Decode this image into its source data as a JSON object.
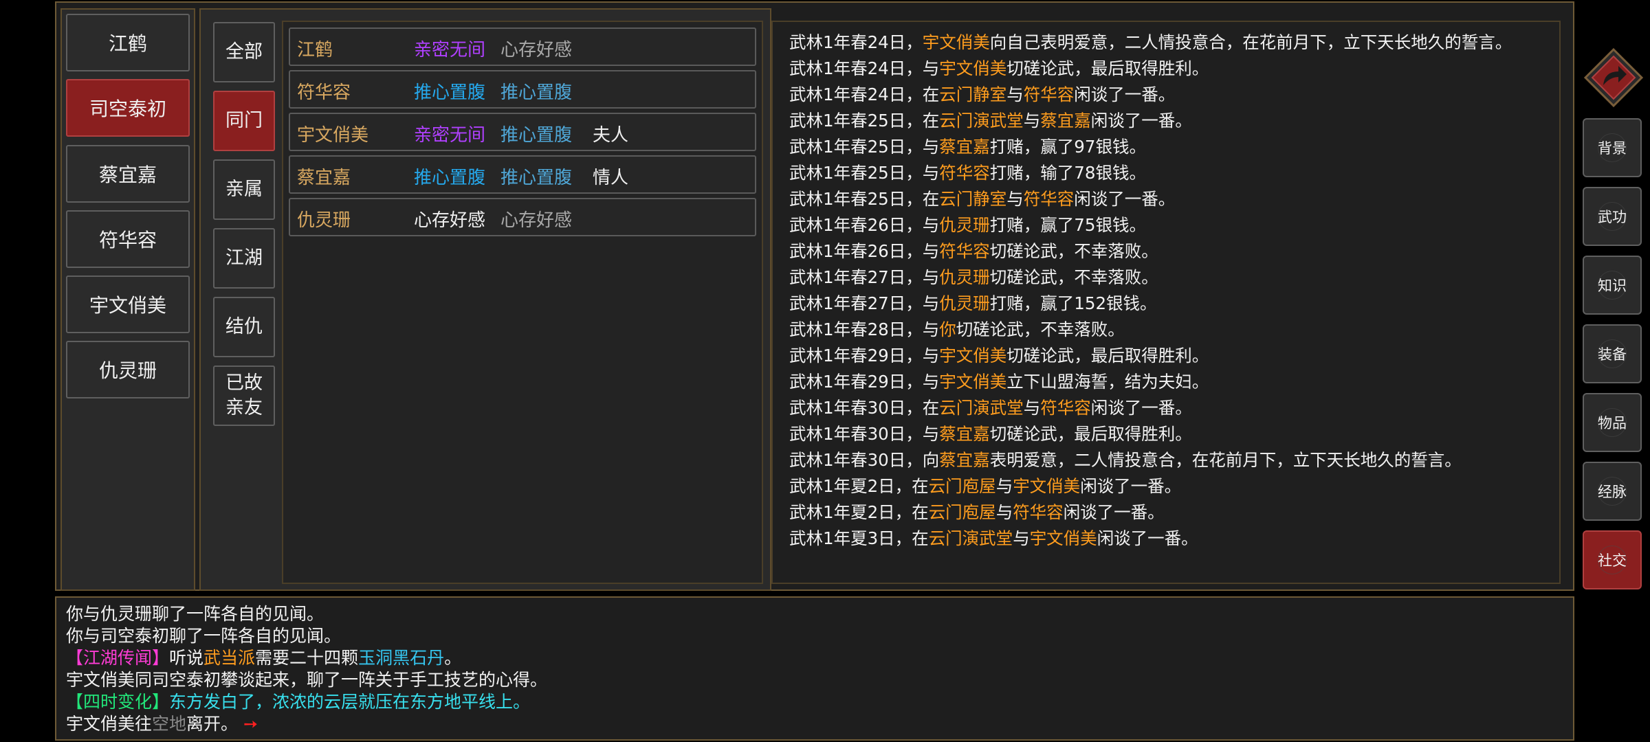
{
  "characters": [
    "江鹤",
    "司空泰初",
    "蔡宜嘉",
    "符华容",
    "宇文俏美",
    "仇灵珊"
  ],
  "active_character_index": 1,
  "categories": [
    "全部",
    "同门",
    "亲属",
    "江湖",
    "结仇",
    "已故\n亲友"
  ],
  "active_category_index": 1,
  "colors": {
    "purple": "#b040ff",
    "blue": "#25a8ec",
    "light_blue": "#4fa6d6",
    "white": "#f0f0f0",
    "gray": "#a8a8a8",
    "name_gold": "#d8a860",
    "highlight_orange": "#ff9d1e",
    "active_red": "#8a1f1f"
  },
  "relationships": [
    {
      "name": "江鹤",
      "s1": "亲密无间",
      "s1_color": "#b040ff",
      "s2": "心存好感",
      "s2_color": "#a8a8a8",
      "role": ""
    },
    {
      "name": "符华容",
      "s1": "推心置腹",
      "s1_color": "#25a8ec",
      "s2": "推心置腹",
      "s2_color": "#4fa6d6",
      "role": ""
    },
    {
      "name": "宇文俏美",
      "s1": "亲密无间",
      "s1_color": "#b040ff",
      "s2": "推心置腹",
      "s2_color": "#4fa6d6",
      "role": "夫人"
    },
    {
      "name": "蔡宜嘉",
      "s1": "推心置腹",
      "s1_color": "#25a8ec",
      "s2": "推心置腹",
      "s2_color": "#4fa6d6",
      "role": "情人"
    },
    {
      "name": "仇灵珊",
      "s1": "心存好感",
      "s1_color": "#f0f0f0",
      "s2": "心存好感",
      "s2_color": "#a8a8a8",
      "role": ""
    }
  ],
  "event_log": [
    [
      {
        "t": "武林1年春24日，"
      },
      {
        "t": "宇文俏美",
        "h": true
      },
      {
        "t": "向自己表明爱意，二人情投意合，在花前月下，立下天长地久的誓言。"
      }
    ],
    [
      {
        "t": "武林1年春24日，与"
      },
      {
        "t": "宇文俏美",
        "h": true
      },
      {
        "t": "切磋论武，最后取得胜利。"
      }
    ],
    [
      {
        "t": "武林1年春24日，在"
      },
      {
        "t": "云门静室",
        "h": true
      },
      {
        "t": "与"
      },
      {
        "t": "符华容",
        "h": true
      },
      {
        "t": "闲谈了一番。"
      }
    ],
    [
      {
        "t": "武林1年春25日，在"
      },
      {
        "t": "云门演武堂",
        "h": true
      },
      {
        "t": "与"
      },
      {
        "t": "蔡宜嘉",
        "h": true
      },
      {
        "t": "闲谈了一番。"
      }
    ],
    [
      {
        "t": "武林1年春25日，与"
      },
      {
        "t": "蔡宜嘉",
        "h": true
      },
      {
        "t": "打赌，赢了97银钱。"
      }
    ],
    [
      {
        "t": "武林1年春25日，与"
      },
      {
        "t": "符华容",
        "h": true
      },
      {
        "t": "打赌，输了78银钱。"
      }
    ],
    [
      {
        "t": "武林1年春25日，在"
      },
      {
        "t": "云门静室",
        "h": true
      },
      {
        "t": "与"
      },
      {
        "t": "符华容",
        "h": true
      },
      {
        "t": "闲谈了一番。"
      }
    ],
    [
      {
        "t": "武林1年春26日，与"
      },
      {
        "t": "仇灵珊",
        "h": true
      },
      {
        "t": "打赌，赢了75银钱。"
      }
    ],
    [
      {
        "t": "武林1年春26日，与"
      },
      {
        "t": "符华容",
        "h": true
      },
      {
        "t": "切磋论武，不幸落败。"
      }
    ],
    [
      {
        "t": "武林1年春27日，与"
      },
      {
        "t": "仇灵珊",
        "h": true
      },
      {
        "t": "切磋论武，不幸落败。"
      }
    ],
    [
      {
        "t": "武林1年春27日，与"
      },
      {
        "t": "仇灵珊",
        "h": true
      },
      {
        "t": "打赌，赢了152银钱。"
      }
    ],
    [
      {
        "t": "武林1年春28日，与"
      },
      {
        "t": "你",
        "h": true
      },
      {
        "t": "切磋论武，不幸落败。"
      }
    ],
    [
      {
        "t": "武林1年春29日，与"
      },
      {
        "t": "宇文俏美",
        "h": true
      },
      {
        "t": "切磋论武，最后取得胜利。"
      }
    ],
    [
      {
        "t": "武林1年春29日，与"
      },
      {
        "t": "宇文俏美",
        "h": true
      },
      {
        "t": "立下山盟海誓，结为夫妇。"
      }
    ],
    [
      {
        "t": "武林1年春30日，在"
      },
      {
        "t": "云门演武堂",
        "h": true
      },
      {
        "t": "与"
      },
      {
        "t": "符华容",
        "h": true
      },
      {
        "t": "闲谈了一番。"
      }
    ],
    [
      {
        "t": "武林1年春30日，与"
      },
      {
        "t": "蔡宜嘉",
        "h": true
      },
      {
        "t": "切磋论武，最后取得胜利。"
      }
    ],
    [
      {
        "t": "武林1年春30日，向"
      },
      {
        "t": "蔡宜嘉",
        "h": true
      },
      {
        "t": "表明爱意，二人情投意合，在花前月下，立下天长地久的誓言。"
      }
    ],
    [
      {
        "t": "武林1年夏2日，在"
      },
      {
        "t": "云门庖屋",
        "h": true
      },
      {
        "t": "与"
      },
      {
        "t": "宇文俏美",
        "h": true
      },
      {
        "t": "闲谈了一番。"
      }
    ],
    [
      {
        "t": "武林1年夏2日，在"
      },
      {
        "t": "云门庖屋",
        "h": true
      },
      {
        "t": "与"
      },
      {
        "t": "符华容",
        "h": true
      },
      {
        "t": "闲谈了一番。"
      }
    ],
    [
      {
        "t": "武林1年夏3日，在"
      },
      {
        "t": "云门演武堂",
        "h": true
      },
      {
        "t": "与"
      },
      {
        "t": "宇文俏美",
        "h": true
      },
      {
        "t": "闲谈了一番。"
      }
    ]
  ],
  "messages": [
    [
      {
        "t": "你与仇灵珊聊了一阵各自的见闻。"
      }
    ],
    [
      {
        "t": "你与司空泰初聊了一阵各自的见闻。"
      }
    ],
    [
      {
        "t": "【江湖传闻】",
        "c": "c-mag"
      },
      {
        "t": "听说"
      },
      {
        "t": "武当派",
        "c": "c-orange"
      },
      {
        "t": "需要二十四颗"
      },
      {
        "t": "玉洞黑石丹",
        "c": "c-cyan"
      },
      {
        "t": "。"
      }
    ],
    [
      {
        "t": "宇文俏美同司空泰初攀谈起来，聊了一阵关于手工技艺的心得。"
      }
    ],
    [
      {
        "t": "【四时变化】",
        "c": "c-green"
      },
      {
        "t": "东方发白了，浓浓的云层就压在东方地平线上。",
        "c": "c-aqua"
      }
    ],
    [
      {
        "t": "宇文俏美往"
      },
      {
        "t": "空地",
        "c": "c-gray"
      },
      {
        "t": "离开。"
      },
      {
        "t": " ➙",
        "c": "c-red"
      }
    ]
  ],
  "side_menu": [
    "背景",
    "武功",
    "知识",
    "装备",
    "物品",
    "经脉",
    "社交"
  ],
  "active_side_index": 6,
  "icons": {
    "back": "return-arrow-icon"
  }
}
